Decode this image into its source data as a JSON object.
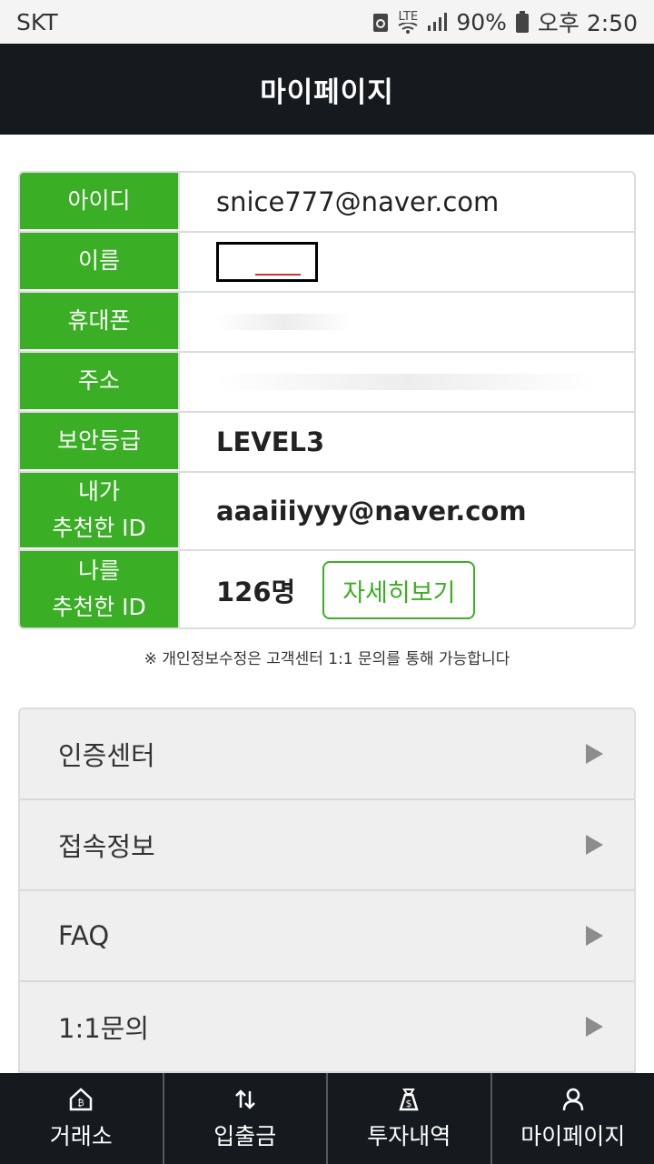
{
  "status_bar": {
    "carrier": "SKT",
    "network": "LTE",
    "battery": "90%",
    "time": "오후 2:50"
  },
  "header": {
    "title": "마이페이지"
  },
  "profile": {
    "rows": [
      {
        "label": "아이디",
        "value": "snice777@naver.com"
      },
      {
        "label": "이름",
        "value": ""
      },
      {
        "label": "휴대폰",
        "value": ""
      },
      {
        "label": "주소",
        "value": ""
      },
      {
        "label": "보안등급",
        "value": "LEVEL3"
      },
      {
        "label_line1": "내가",
        "label_line2": "추천한 ID",
        "value": "aaaiiiyyy@naver.com"
      },
      {
        "label_line1": "나를",
        "label_line2": "추천한 ID",
        "value": "126명",
        "button": "자세히보기"
      }
    ]
  },
  "note": "※ 개인정보수정은 고객센터 1:1 문의를 통해 가능합니다",
  "menu": {
    "items": [
      {
        "label": "인증센터"
      },
      {
        "label": "접속정보"
      },
      {
        "label": "FAQ"
      },
      {
        "label": "1:1문의"
      }
    ]
  },
  "bottom_nav": {
    "items": [
      {
        "label": "거래소",
        "icon": "house-icon"
      },
      {
        "label": "입출금",
        "icon": "transfer-arrows-icon"
      },
      {
        "label": "투자내역",
        "icon": "money-bag-icon"
      },
      {
        "label": "마이페이지",
        "icon": "user-icon"
      }
    ]
  },
  "colors": {
    "accent": "#3aae24",
    "header_bg": "#151a1e",
    "menu_bg": "#eeeeee"
  }
}
